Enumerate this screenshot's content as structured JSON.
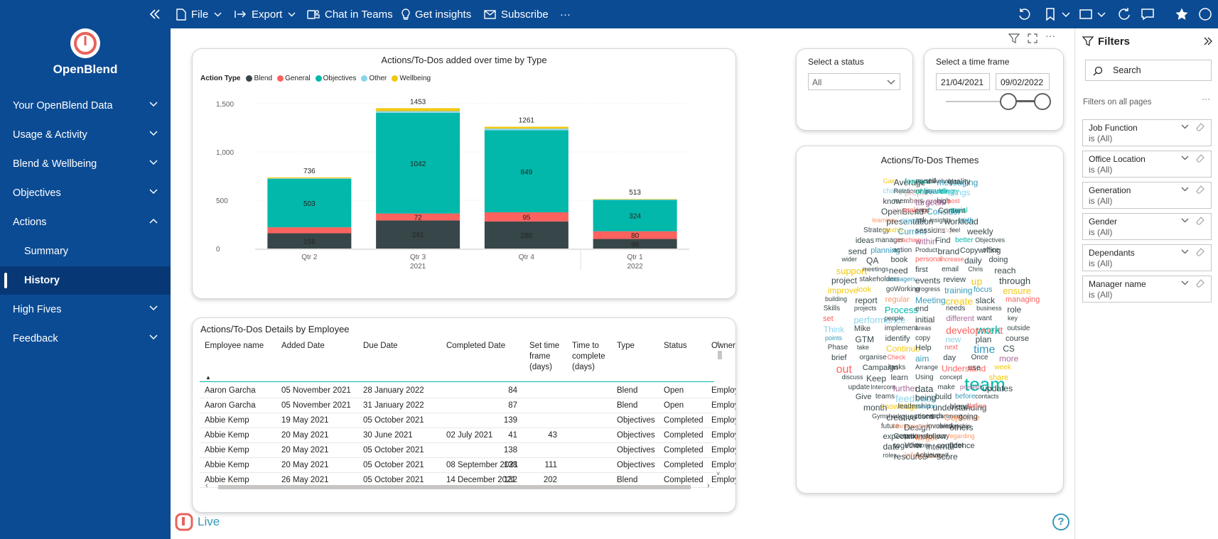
{
  "toolbar": {
    "file": "File",
    "export": "Export",
    "chat_in_teams": "Chat in Teams",
    "get_insights": "Get insights",
    "subscribe": "Subscribe",
    "more": "···"
  },
  "brand": {
    "name": "OpenBlend",
    "live": "Live",
    "accent": "#e8635b"
  },
  "nav": {
    "items": [
      {
        "label": "Your OpenBlend Data"
      },
      {
        "label": "Usage & Activity"
      },
      {
        "label": "Blend & Wellbeing"
      },
      {
        "label": "Objectives"
      },
      {
        "label": "Actions"
      },
      {
        "label": "Summary"
      },
      {
        "label": "History"
      },
      {
        "label": "High Fives"
      },
      {
        "label": "Feedback"
      }
    ]
  },
  "chart_data": {
    "type": "bar",
    "title": "Actions/To-Dos added over time by Type",
    "legend_title": "Action Type",
    "categories": [
      "Qtr 2",
      "Qtr 3",
      "Qtr 4",
      "Qtr 1"
    ],
    "year_labels": [
      "2021",
      "2022"
    ],
    "ylim": [
      0,
      1500
    ],
    "yticks": [
      {
        "value": 0,
        "label": "0"
      },
      {
        "value": 500,
        "label": "500"
      },
      {
        "value": 1000,
        "label": "1,000"
      },
      {
        "value": 1500,
        "label": "1,500"
      }
    ],
    "totals": [
      "736",
      "1453",
      "1261",
      "513"
    ],
    "series": [
      {
        "name": "Blend",
        "color": "#374649",
        "values": [
          158,
          291,
          280,
          99
        ],
        "labels": [
          "158",
          "291",
          "280",
          "99"
        ]
      },
      {
        "name": "General",
        "color": "#fd625e",
        "values": [
          62,
          72,
          95,
          80
        ],
        "labels": [
          "",
          "72",
          "95",
          "80"
        ]
      },
      {
        "name": "Objectives",
        "color": "#01b8aa",
        "values": [
          503,
          1042,
          849,
          324
        ],
        "labels": [
          "503",
          "1042",
          "849",
          "324"
        ]
      },
      {
        "name": "Other",
        "color": "#8ad4eb",
        "values": [
          4,
          18,
          18,
          5
        ],
        "labels": [
          "",
          "",
          "",
          ""
        ]
      },
      {
        "name": "Wellbeing",
        "color": "#f2c80f",
        "values": [
          9,
          30,
          19,
          5
        ],
        "labels": [
          "",
          "",
          "",
          ""
        ]
      }
    ]
  },
  "slicers": {
    "status": {
      "title": "Select a status",
      "value": "All"
    },
    "timeframe": {
      "title": "Select a time frame",
      "start": "21/04/2021",
      "end": "09/02/2022"
    }
  },
  "table": {
    "title": "Actions/To-Dos Details by Employee",
    "columns": [
      "Employee name",
      "Added Date",
      "Due Date",
      "Completed Date",
      "Set time frame (days)",
      "Time to complete (days)",
      "Type",
      "Status",
      "Owner"
    ],
    "rows": [
      [
        "Aaron Garcha",
        "05 November 2021",
        "28 January 2022",
        "",
        "84",
        "",
        "Blend",
        "Open",
        "Employee"
      ],
      [
        "Aaron Garcha",
        "05 November 2021",
        "31 January 2022",
        "",
        "87",
        "",
        "Blend",
        "Open",
        "Employee & M"
      ],
      [
        "Abbie Kemp",
        "19 May 2021",
        "05 October 2021",
        "",
        "139",
        "",
        "Objectives",
        "Completed",
        "Employee"
      ],
      [
        "Abbie Kemp",
        "20 May 2021",
        "30 June 2021",
        "02 July 2021",
        "41",
        "43",
        "Objectives",
        "Completed",
        "Employee"
      ],
      [
        "Abbie Kemp",
        "20 May 2021",
        "05 October 2021",
        "",
        "138",
        "",
        "Objectives",
        "Completed",
        "Employee"
      ],
      [
        "Abbie Kemp",
        "20 May 2021",
        "05 October 2021",
        "08 September 2021",
        "138",
        "111",
        "Objectives",
        "Completed",
        "Employee"
      ],
      [
        "Abbie Kemp",
        "26 May 2021",
        "05 October 2021",
        "14 December 2021",
        "132",
        "202",
        "Blend",
        "Completed",
        "Employee"
      ]
    ]
  },
  "wordcloud": {
    "title": "Actions/To-Dos Themes",
    "words": [
      {
        "t": "Gain",
        "c": "#f2c80f"
      },
      {
        "t": "Average",
        "c": "#374649"
      },
      {
        "t": "forward",
        "c": "#01b8aa"
      },
      {
        "t": "myself",
        "c": "#374649"
      },
      {
        "t": "stakeholder",
        "c": "#374649"
      },
      {
        "t": "messaging",
        "c": "#3599b8"
      },
      {
        "t": "quality",
        "c": "#374649"
      },
      {
        "t": "changes",
        "c": "#8ad4eb"
      },
      {
        "t": "Relationships",
        "c": "#374649"
      },
      {
        "t": "prepare",
        "c": "#dfbfbf"
      },
      {
        "t": "onboarding",
        "c": "#01b8aa"
      },
      {
        "t": "issues",
        "c": "#3599b8"
      },
      {
        "t": "delivery",
        "c": "#01b8aa"
      },
      {
        "t": "things",
        "c": "#8ad4eb"
      },
      {
        "t": "know",
        "c": "#374649"
      },
      {
        "t": "members",
        "c": "#374649"
      },
      {
        "t": "made",
        "c": "#dfbfbf"
      },
      {
        "t": "targets",
        "c": "#a66999"
      },
      {
        "t": "group",
        "c": "#a66999"
      },
      {
        "t": "high",
        "c": "#374649"
      },
      {
        "t": "post",
        "c": "#fd625e"
      },
      {
        "t": "OpenBlend",
        "c": "#374649"
      },
      {
        "t": "steps",
        "c": "#dfbfbf"
      },
      {
        "t": "making",
        "c": "#fd625e"
      },
      {
        "t": "good",
        "c": "#374649"
      },
      {
        "t": "Consider",
        "c": "#3599b8"
      },
      {
        "t": "Content",
        "c": "#374649"
      },
      {
        "t": "social",
        "c": "#01b8aa"
      },
      {
        "t": "learning",
        "c": "#fe9666"
      },
      {
        "t": "presentation",
        "c": "#374649"
      },
      {
        "t": "agents",
        "c": "#8ad4eb"
      },
      {
        "t": "ask",
        "c": "#374649"
      },
      {
        "t": "insights",
        "c": "#374649"
      },
      {
        "t": "workload",
        "c": "#374649"
      },
      {
        "t": "both",
        "c": "#3599b8"
      },
      {
        "t": "Strategy",
        "c": "#374649"
      },
      {
        "t": "monthly",
        "c": "#f2c80f"
      },
      {
        "t": "Current",
        "c": "#3599b8"
      },
      {
        "t": "sessions",
        "c": "#374649"
      },
      {
        "t": "change",
        "c": "#dfbfbf"
      },
      {
        "t": "feel",
        "c": "#374649"
      },
      {
        "t": "weekly",
        "c": "#374649"
      },
      {
        "t": "ideas",
        "c": "#374649"
      },
      {
        "t": "manager",
        "c": "#374649"
      },
      {
        "t": "coaching",
        "c": "#fd625e"
      },
      {
        "t": "within",
        "c": "#a66999"
      },
      {
        "t": "Find",
        "c": "#374649"
      },
      {
        "t": "better",
        "c": "#01b8aa"
      },
      {
        "t": "Objectives",
        "c": "#374649"
      },
      {
        "t": "send",
        "c": "#374649"
      },
      {
        "t": "planning",
        "c": "#3599b8"
      },
      {
        "t": "action",
        "c": "#374649"
      },
      {
        "t": "Product",
        "c": "#374649"
      },
      {
        "t": "brand",
        "c": "#374649"
      },
      {
        "t": "Copywriting",
        "c": "#374649"
      },
      {
        "t": "office",
        "c": "#374649"
      },
      {
        "t": "wider",
        "c": "#374649"
      },
      {
        "t": "QA",
        "c": "#374649"
      },
      {
        "t": "book",
        "c": "#374649"
      },
      {
        "t": "personal",
        "c": "#fd625e"
      },
      {
        "t": "increase",
        "c": "#fd625e"
      },
      {
        "t": "daily",
        "c": "#374649"
      },
      {
        "t": "doing",
        "c": "#374649"
      },
      {
        "t": "support",
        "c": "#f2c80f"
      },
      {
        "t": "meetings",
        "c": "#374649"
      },
      {
        "t": "need",
        "c": "#374649"
      },
      {
        "t": "first",
        "c": "#374649"
      },
      {
        "t": "email",
        "c": "#374649"
      },
      {
        "t": "Chris",
        "c": "#374649"
      },
      {
        "t": "reach",
        "c": "#374649"
      },
      {
        "t": "project",
        "c": "#374649"
      },
      {
        "t": "stakeholders",
        "c": "#374649"
      },
      {
        "t": "managers",
        "c": "#3599b8"
      },
      {
        "t": "events",
        "c": "#374649"
      },
      {
        "t": "review",
        "c": "#374649"
      },
      {
        "t": "up",
        "c": "#f2c80f"
      },
      {
        "t": "through",
        "c": "#374649"
      },
      {
        "t": "improve",
        "c": "#f2c80f"
      },
      {
        "t": "look",
        "c": "#f2c80f"
      },
      {
        "t": "goWorking",
        "c": "#374649"
      },
      {
        "t": "progress",
        "c": "#374649"
      },
      {
        "t": "training",
        "c": "#3599b8"
      },
      {
        "t": "focus",
        "c": "#3599b8"
      },
      {
        "t": "ensure",
        "c": "#f2c80f"
      },
      {
        "t": "building",
        "c": "#374649"
      },
      {
        "t": "report",
        "c": "#374649"
      },
      {
        "t": "regular",
        "c": "#fe9666"
      },
      {
        "t": "Meeting",
        "c": "#3599b8"
      },
      {
        "t": "create",
        "c": "#f2c80f"
      },
      {
        "t": "slack",
        "c": "#374649"
      },
      {
        "t": "managing",
        "c": "#fd625e"
      },
      {
        "t": "Skills",
        "c": "#374649"
      },
      {
        "t": "projects",
        "c": "#374649"
      },
      {
        "t": "Process",
        "c": "#01b8aa"
      },
      {
        "t": "end",
        "c": "#374649"
      },
      {
        "t": "needs",
        "c": "#374649"
      },
      {
        "t": "business",
        "c": "#374649"
      },
      {
        "t": "role",
        "c": "#374649"
      },
      {
        "t": "set",
        "c": "#fd625e"
      },
      {
        "t": "performance",
        "c": "#8ad4eb"
      },
      {
        "t": "people",
        "c": "#374649"
      },
      {
        "t": "initial",
        "c": "#374649"
      },
      {
        "t": "different",
        "c": "#a66999"
      },
      {
        "t": "want",
        "c": "#374649"
      },
      {
        "t": "key",
        "c": "#374649"
      },
      {
        "t": "Think",
        "c": "#8ad4eb"
      },
      {
        "t": "Mike",
        "c": "#374649"
      },
      {
        "t": "implement",
        "c": "#374649"
      },
      {
        "t": "areas",
        "c": "#374649"
      },
      {
        "t": "development",
        "c": "#fd625e"
      },
      {
        "t": "work",
        "c": "#01b8aa"
      },
      {
        "t": "outside",
        "c": "#374649"
      },
      {
        "t": "points",
        "c": "#3599b8"
      },
      {
        "t": "GTM",
        "c": "#374649"
      },
      {
        "t": "identify",
        "c": "#374649"
      },
      {
        "t": "copy",
        "c": "#374649"
      },
      {
        "t": "new",
        "c": "#8ad4eb"
      },
      {
        "t": "plan",
        "c": "#374649"
      },
      {
        "t": "course",
        "c": "#374649"
      },
      {
        "t": "Phase",
        "c": "#374649"
      },
      {
        "t": "take",
        "c": "#374649"
      },
      {
        "t": "Continue",
        "c": "#f2c80f"
      },
      {
        "t": "Help",
        "c": "#374649"
      },
      {
        "t": "next",
        "c": "#fd625e"
      },
      {
        "t": "time",
        "c": "#3599b8"
      },
      {
        "t": "CS",
        "c": "#374649"
      },
      {
        "t": "brief",
        "c": "#374649"
      },
      {
        "t": "organise",
        "c": "#374649"
      },
      {
        "t": "Check",
        "c": "#fd625e"
      },
      {
        "t": "aim",
        "c": "#3599b8"
      },
      {
        "t": "day",
        "c": "#374649"
      },
      {
        "t": "Once",
        "c": "#374649"
      },
      {
        "t": "more",
        "c": "#a66999"
      },
      {
        "t": "out",
        "c": "#fd625e"
      },
      {
        "t": "Campaign",
        "c": "#374649"
      },
      {
        "t": "tasks",
        "c": "#374649"
      },
      {
        "t": "Arrange",
        "c": "#374649"
      },
      {
        "t": "Understand",
        "c": "#fd625e"
      },
      {
        "t": "use",
        "c": "#374649"
      },
      {
        "t": "week",
        "c": "#f2c80f"
      },
      {
        "t": "discuss",
        "c": "#374649"
      },
      {
        "t": "Keep",
        "c": "#374649"
      },
      {
        "t": "learn",
        "c": "#374649"
      },
      {
        "t": "Using",
        "c": "#374649"
      },
      {
        "t": "concept",
        "c": "#374649"
      },
      {
        "t": "team",
        "c": "#01b8aa"
      },
      {
        "t": "share",
        "c": "#f2c80f"
      },
      {
        "t": "update",
        "c": "#374649"
      },
      {
        "t": "Intercom",
        "c": "#374649"
      },
      {
        "t": "further",
        "c": "#a66999"
      },
      {
        "t": "data",
        "c": "#374649"
      },
      {
        "t": "make",
        "c": "#374649"
      },
      {
        "t": "present",
        "c": "#a66999"
      },
      {
        "t": "updates",
        "c": "#374649"
      },
      {
        "t": "Give",
        "c": "#374649"
      },
      {
        "t": "teams",
        "c": "#374649"
      },
      {
        "t": "feedback",
        "c": "#8ad4eb"
      },
      {
        "t": "being",
        "c": "#374649"
      },
      {
        "t": "build",
        "c": "#374649"
      },
      {
        "t": "before",
        "c": "#3599b8"
      },
      {
        "t": "contacts",
        "c": "#374649"
      },
      {
        "t": "month",
        "c": "#374649"
      },
      {
        "t": "knowledge",
        "c": "#f2c80f"
      },
      {
        "t": "leadership",
        "c": "#374649"
      },
      {
        "t": "session",
        "c": "#3599b8"
      },
      {
        "t": "understanding",
        "c": "#374649"
      },
      {
        "t": "blend",
        "c": "#374649"
      },
      {
        "t": "define",
        "c": "#fd625e"
      },
      {
        "t": "Gymshark",
        "c": "#374649"
      },
      {
        "t": "creative",
        "c": "#374649"
      },
      {
        "t": "questions",
        "c": "#374649"
      },
      {
        "t": "research",
        "c": "#374649"
      },
      {
        "t": "department",
        "c": "#374649"
      },
      {
        "t": "Objective",
        "c": "#fe9666"
      },
      {
        "t": "going",
        "c": "#374649"
      },
      {
        "t": "future",
        "c": "#374649"
      },
      {
        "t": "Management",
        "c": "#fe9666"
      },
      {
        "t": "Design",
        "c": "#374649"
      },
      {
        "t": "communication",
        "c": "#dfbfbf"
      },
      {
        "t": "involved",
        "c": "#374649"
      },
      {
        "t": "relationship",
        "c": "#374649"
      },
      {
        "t": "others",
        "c": "#374649"
      },
      {
        "t": "expectations",
        "c": "#374649"
      },
      {
        "t": "Comms",
        "c": "#374649"
      },
      {
        "t": "processes",
        "c": "#374649"
      },
      {
        "t": "target",
        "c": "#fe9666"
      },
      {
        "t": "follow",
        "c": "#374649"
      },
      {
        "t": "way",
        "c": "#374649"
      },
      {
        "t": "regarding",
        "c": "#fe9666"
      },
      {
        "t": "date",
        "c": "#374649"
      },
      {
        "t": "together",
        "c": "#374649"
      },
      {
        "t": "Voice",
        "c": "#374649"
      },
      {
        "t": "those",
        "c": "#374649"
      },
      {
        "t": "internal",
        "c": "#374649"
      },
      {
        "t": "confidence",
        "c": "#374649"
      },
      {
        "t": "meet",
        "c": "#374649"
      },
      {
        "t": "roles",
        "c": "#374649"
      },
      {
        "t": "resource",
        "c": "#374649"
      },
      {
        "t": "information",
        "c": "#fe9666"
      },
      {
        "t": "Achieve",
        "c": "#374649"
      },
      {
        "t": "yourself",
        "c": "#374649"
      },
      {
        "t": "score",
        "c": "#374649"
      }
    ]
  },
  "filters": {
    "title": "Filters",
    "search_placeholder": "Search",
    "section": "Filters on all pages",
    "items": [
      {
        "name": "Job Function",
        "value": "is (All)"
      },
      {
        "name": "Office Location",
        "value": "is (All)"
      },
      {
        "name": "Generation",
        "value": "is (All)"
      },
      {
        "name": "Gender",
        "value": "is (All)"
      },
      {
        "name": "Dependants",
        "value": "is (All)"
      },
      {
        "name": "Manager name",
        "value": "is (All)"
      }
    ]
  }
}
